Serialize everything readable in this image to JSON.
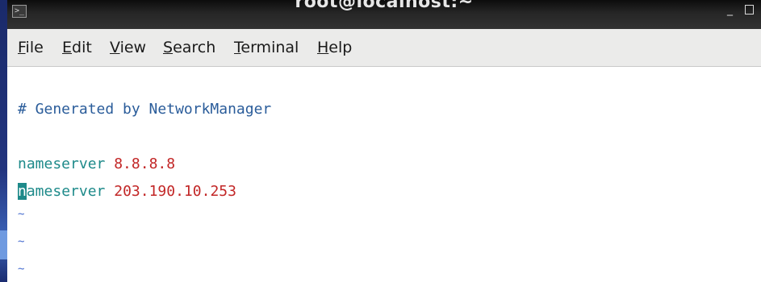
{
  "window": {
    "title": "root@localhost:~",
    "icon": "terminal-icon",
    "controls": {
      "minimize": "_",
      "maximize": "□"
    }
  },
  "menu": {
    "file": {
      "accel": "F",
      "rest": "ile"
    },
    "edit": {
      "accel": "E",
      "rest": "dit"
    },
    "view": {
      "accel": "V",
      "rest": "iew"
    },
    "search": {
      "accel": "S",
      "rest": "earch"
    },
    "terminal": {
      "accel": "T",
      "rest": "erminal"
    },
    "help": {
      "accel": "H",
      "rest": "elp"
    }
  },
  "editor": {
    "comment_line": "# Generated by NetworkManager",
    "lines": [
      {
        "keyword": "nameserver",
        "value": "8.8.8.8"
      },
      {
        "cursor_char": "n",
        "keyword_rest": "ameserver",
        "value": "203.190.10.253"
      }
    ],
    "empty_marker": "~"
  },
  "colors": {
    "comment": "#2a5c9a",
    "keyword": "#1e8a8a",
    "value": "#c22626",
    "tilde": "#4a6fd0"
  }
}
